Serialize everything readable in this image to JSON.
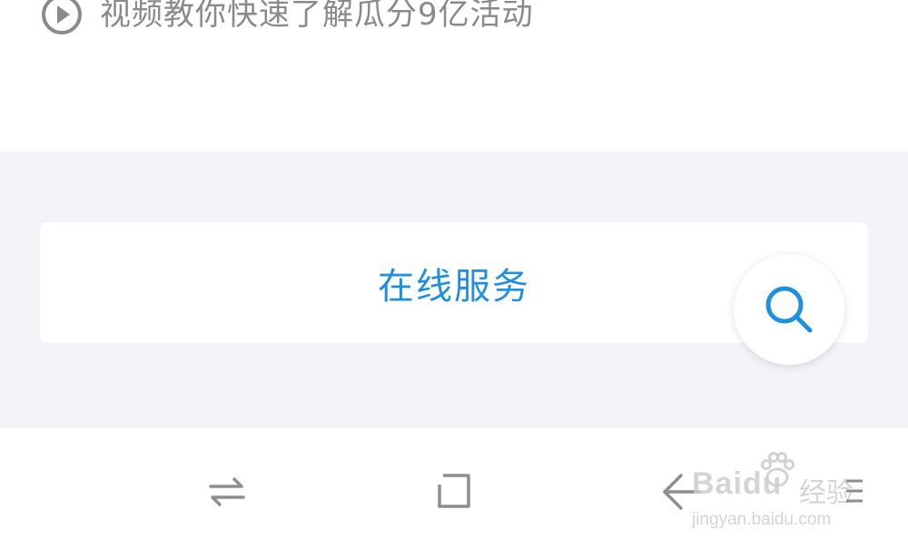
{
  "video_link": {
    "text": "视频教你快速了解瓜分9亿活动",
    "icon": "play-circle-icon"
  },
  "service": {
    "label": "在线服务"
  },
  "search_button": {
    "icon": "search-icon"
  },
  "navigation": {
    "switch_icon": "switch-arrows-icon",
    "home_icon": "square-home-icon",
    "back_icon": "back-arrow-icon",
    "menu_icon": "menu-icon"
  },
  "watermark": {
    "brand": "Baidu",
    "cn": "经验",
    "url": "jingyan.baidu.com"
  },
  "colors": {
    "accent": "#1f8fe0",
    "gray_text": "#8a8a8a",
    "background_gray": "#f3f3f8",
    "nav_icon": "#8e8e8e"
  }
}
